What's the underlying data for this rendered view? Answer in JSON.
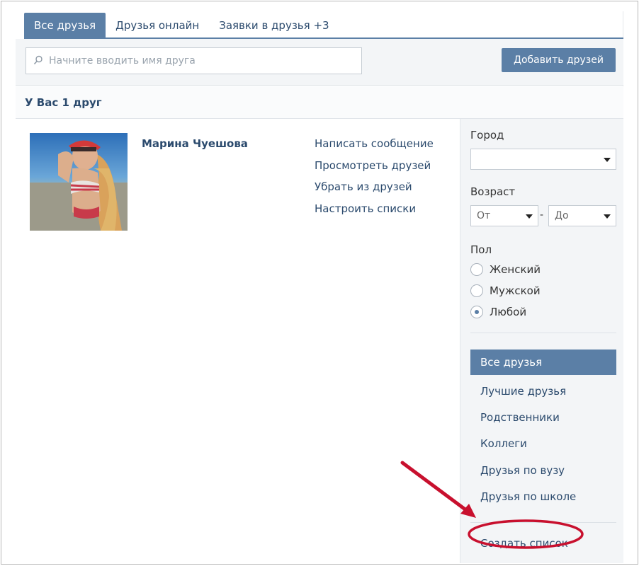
{
  "tabs": [
    {
      "label": "Все друзья"
    },
    {
      "label": "Друзья онлайн"
    },
    {
      "label": "Заявки в друзья +3"
    }
  ],
  "search": {
    "placeholder": "Начните вводить имя друга"
  },
  "add_button": "Добавить друзей",
  "friend_count": "У Вас 1 друг",
  "friend": {
    "name": "Марина Чуешова",
    "actions": [
      "Написать сообщение",
      "Просмотреть друзей",
      "Убрать из друзей",
      "Настроить списки"
    ]
  },
  "filters": {
    "city_label": "Город",
    "city_value": "",
    "age_label": "Возраст",
    "age_from": "От",
    "age_dash": "-",
    "age_to": "До",
    "gender_label": "Пол",
    "gender_options": [
      {
        "label": "Женский",
        "checked": false
      },
      {
        "label": "Мужской",
        "checked": false
      },
      {
        "label": "Любой",
        "checked": true
      }
    ]
  },
  "lists": {
    "active": "Все друзья",
    "items": [
      "Лучшие друзья",
      "Родственники",
      "Коллеги",
      "Друзья по вузу",
      "Друзья по школе"
    ],
    "create": "Создать список"
  },
  "colors": {
    "accent": "#5b7fa6",
    "link": "#2b4a6d",
    "annotation": "#c8102e"
  },
  "icons": {
    "search": "search-icon",
    "caret": "chevron-down-icon"
  }
}
